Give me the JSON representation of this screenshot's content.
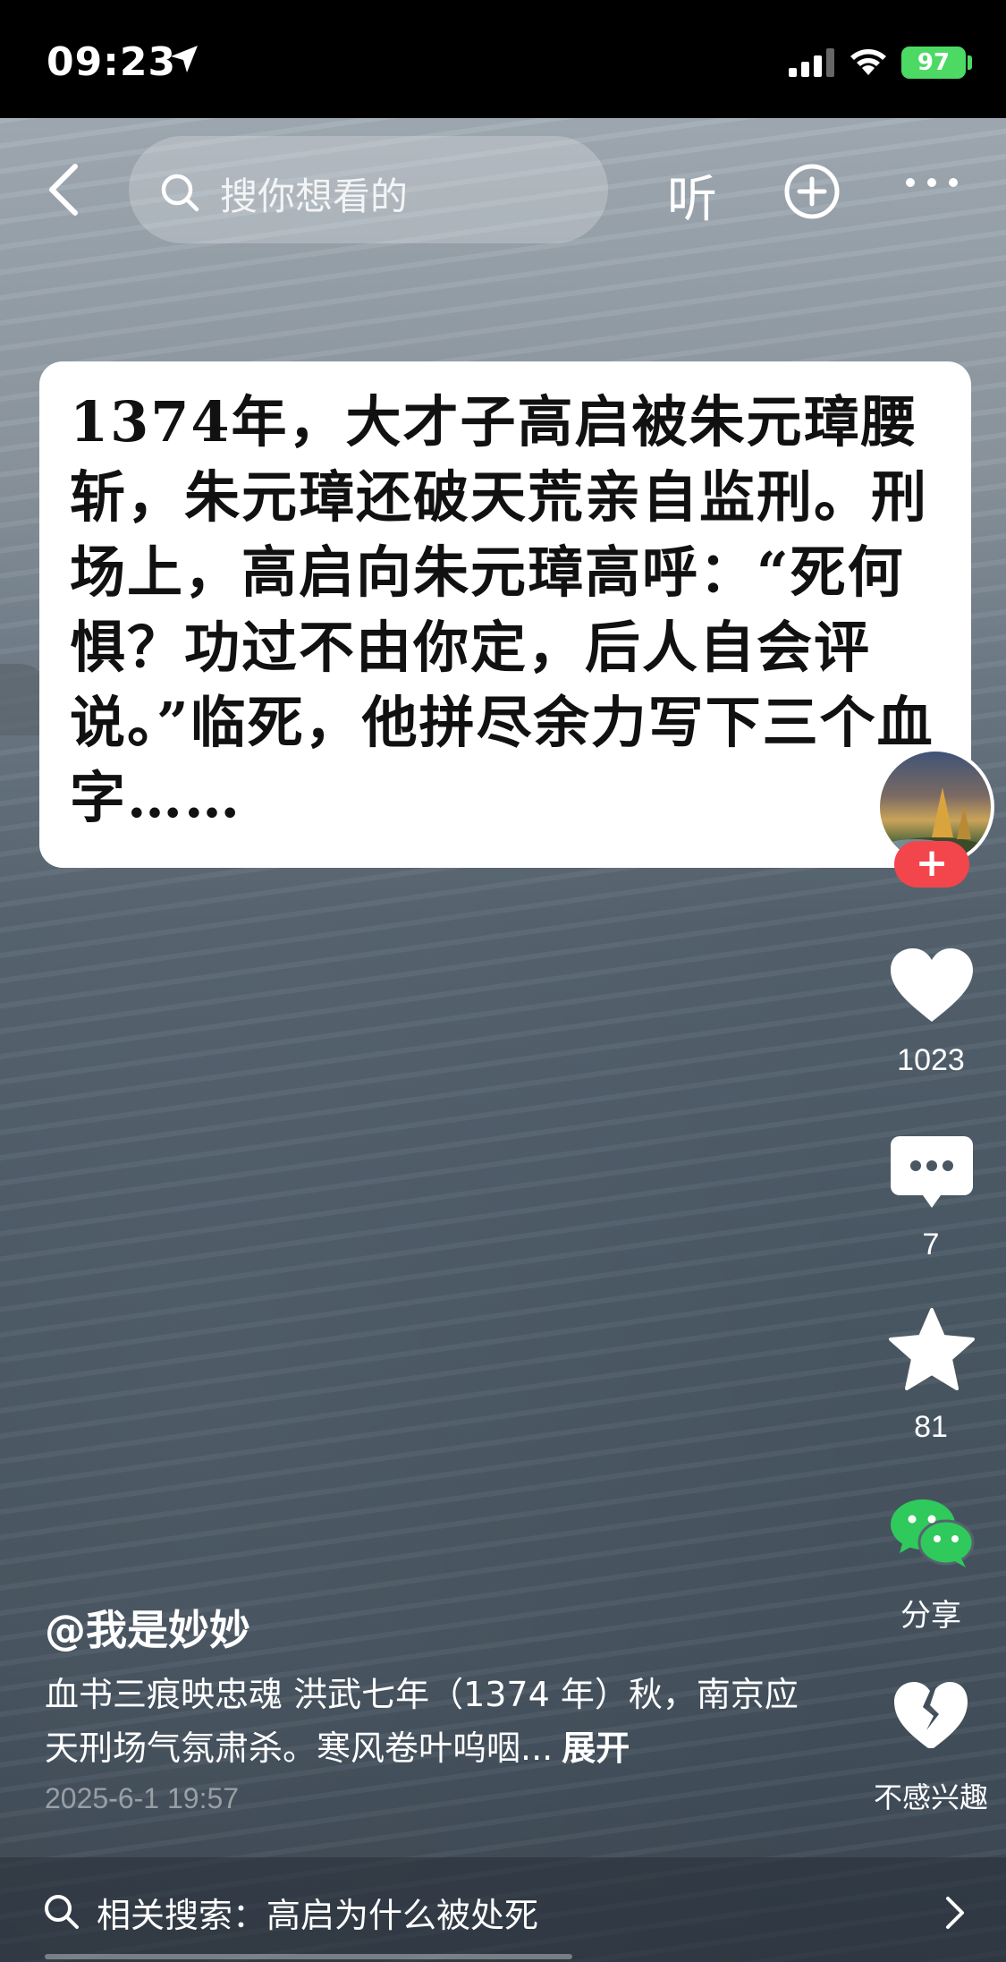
{
  "status_bar": {
    "time": "09:23",
    "battery": "97"
  },
  "top_bar": {
    "search_placeholder": "搜你想看的",
    "listen_label": "听"
  },
  "card": {
    "text": "1374年，大才子高启被朱元璋腰斩，朱元璋还破天荒亲自监刑。刑场上，高启向朱元璋高呼：“死何惧？功过不由你定，后人自会评说。”临死，他拼尽余力写下三个血字……"
  },
  "actions": {
    "likes": "1023",
    "comments": "7",
    "favorites": "81",
    "share_label": "分享",
    "not_interested_label": "不感兴趣",
    "follow_symbol": "+"
  },
  "post": {
    "author": "@我是妙妙",
    "description": "血书三痕映忠魂 洪武七年（1374 年）秋，南京应天刑场气氛肃杀。寒风卷叶呜咽...",
    "expand_label": "展开",
    "date": "2025-6-1 19:57"
  },
  "related_search": {
    "text": "相关搜索：高启为什么被处死"
  },
  "colors": {
    "accent_red": "#f2464c",
    "wechat_green": "#2fc95c",
    "battery_green": "#4cd964"
  }
}
